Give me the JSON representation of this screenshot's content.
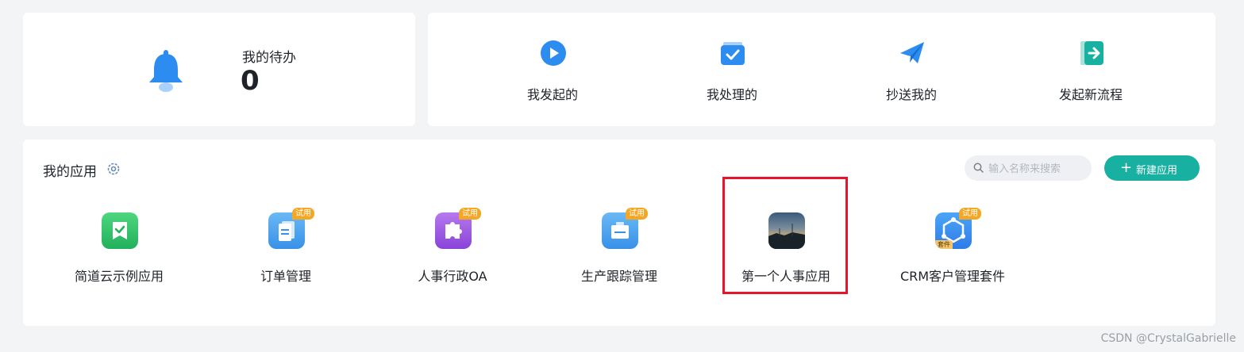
{
  "todo": {
    "label": "我的待办",
    "count": "0",
    "icon": "bell-icon"
  },
  "quick_actions": [
    {
      "label": "我发起的",
      "icon": "play-circle-icon"
    },
    {
      "label": "我处理的",
      "icon": "check-box-icon"
    },
    {
      "label": "抄送我的",
      "icon": "paper-plane-icon"
    },
    {
      "label": "发起新流程",
      "icon": "exit-arrow-icon"
    }
  ],
  "apps_section": {
    "title": "我的应用",
    "search_placeholder": "输入名称来搜索",
    "new_button": "新建应用"
  },
  "apps": [
    {
      "name": "简道云示例应用",
      "badge": "",
      "icon": "bookmark-check-icon"
    },
    {
      "name": "订单管理",
      "badge": "试用",
      "icon": "document-icon"
    },
    {
      "name": "人事行政OA",
      "badge": "试用",
      "icon": "puzzle-icon"
    },
    {
      "name": "生产跟踪管理",
      "badge": "试用",
      "icon": "tray-icon"
    },
    {
      "name": "第一个人事应用",
      "badge": "",
      "icon": "landscape-photo-icon"
    },
    {
      "name": "CRM客户管理套件",
      "badge": "试用",
      "suite": "套件",
      "icon": "network-icon"
    }
  ],
  "colors": {
    "accent": "#18b0a0",
    "primary_blue": "#2d8cf0",
    "badge": "#f5a623",
    "highlight": "#e8142b"
  },
  "watermark": "CSDN @CrystalGabrielle"
}
